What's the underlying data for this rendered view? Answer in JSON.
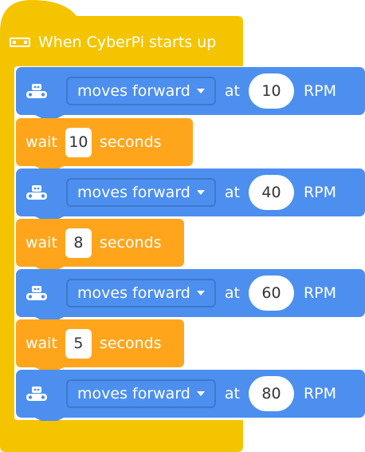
{
  "colors": {
    "event": "#f5c400",
    "motion": "#4c8fef",
    "control": "#ffa51c",
    "input_bg": "#ffffff",
    "input_text": "#333333"
  },
  "hat": {
    "icon": "cyberpi-icon",
    "label": "When CyberPi starts up"
  },
  "blocks": [
    {
      "type": "motion",
      "icon": "robot-icon",
      "dropdown": "moves forward",
      "at": "at",
      "value": "10",
      "unit": "RPM"
    },
    {
      "type": "wait",
      "label": "wait",
      "value": "10",
      "suffix": "seconds"
    },
    {
      "type": "motion",
      "icon": "robot-icon",
      "dropdown": "moves forward",
      "at": "at",
      "value": "40",
      "unit": "RPM"
    },
    {
      "type": "wait",
      "label": "wait",
      "value": "8",
      "suffix": "seconds"
    },
    {
      "type": "motion",
      "icon": "robot-icon",
      "dropdown": "moves forward",
      "at": "at",
      "value": "60",
      "unit": "RPM"
    },
    {
      "type": "wait",
      "label": "wait",
      "value": "5",
      "suffix": "seconds"
    },
    {
      "type": "motion",
      "icon": "robot-icon",
      "dropdown": "moves forward",
      "at": "at",
      "value": "80",
      "unit": "RPM"
    }
  ]
}
